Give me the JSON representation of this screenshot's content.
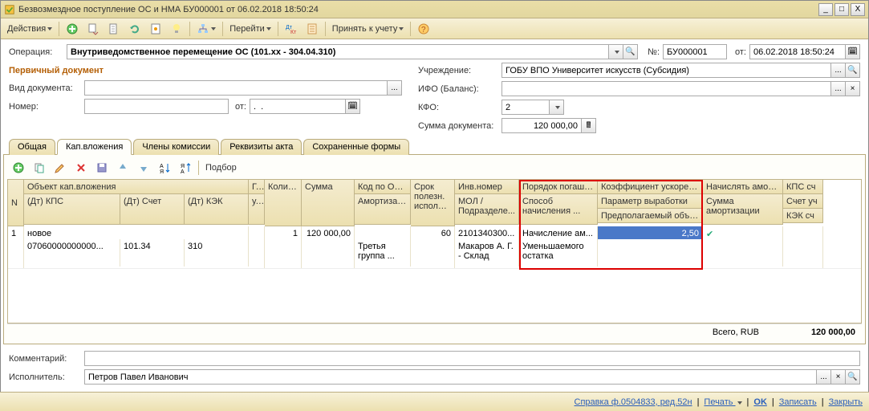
{
  "window": {
    "title": "Безвозмездное поступление ОС и НМА БУ000001 от 06.02.2018 18:50:24"
  },
  "toolbar": {
    "actions": "Действия",
    "goto": "Перейти",
    "accept": "Принять к учету"
  },
  "header": {
    "operation_label": "Операция:",
    "operation": "Внутриведомственное перемещение ОС (101.xx - 304.04.310)",
    "num_label": "№:",
    "num": "БУ000001",
    "from_label": "от:",
    "date": "06.02.2018 18:50:24"
  },
  "left": {
    "section": "Первичный документ",
    "doc_type_label": "Вид документа:",
    "doc_type": "",
    "number_label": "Номер:",
    "number": "",
    "number_from_label": "от:",
    "number_date": ".  .    "
  },
  "right": {
    "org_label": "Учреждение:",
    "org": "ГОБУ ВПО Университет искусств (Субсидия)",
    "ifo_label": "ИФО (Баланс):",
    "ifo": "",
    "kfo_label": "КФО:",
    "kfo": "2",
    "sum_label": "Сумма документа:",
    "sum": "120 000,00"
  },
  "tabs": {
    "t1": "Общая",
    "t2": "Кап.вложения",
    "t3": "Члены комиссии",
    "t4": "Реквизиты акта",
    "t5": "Сохраненные формы"
  },
  "grid_toolbar": {
    "selection": "Подбор"
  },
  "cols": {
    "n": "N",
    "obj": "Объект кап.вложения",
    "dtkps": "(Дт) КПС",
    "dtacc": "(Дт) Счет",
    "dtkek": "(Дт) КЭК",
    "g": "Г...",
    "u": "у...",
    "qty": "Колич...",
    "sum": "Сумма",
    "ok": "Код по ОК...",
    "amort": "Амортизац...",
    "life": "Срок полезн. использ...",
    "inv": "Инв.номер",
    "mol": "МОЛ / Подразделе...",
    "repay": "Порядок погаше...",
    "method": "Способ начисления ...",
    "coef": "Коэффициент ускорения",
    "param": "Параметр выработки",
    "vol": "Предполагаемый объем...",
    "calc": "Начислять аморти...",
    "sumam": "Сумма амортизации",
    "kpsacc": "КПС сч",
    "ktacc": "Счет уч",
    "kekacc": "КЭК сч"
  },
  "row": {
    "n": "1",
    "obj": "новое",
    "kps": "07060000000000...",
    "acc": "101.34",
    "kek": "310",
    "qty": "1",
    "sum": "120 000,00",
    "amort": "Третья группа ...",
    "life": "60",
    "inv": "2101340300...",
    "mol": "Макаров А. Г. - Склад",
    "method1": "Начисление ам...",
    "method2": "Уменьшаемого остатка",
    "coef": "2,50",
    "check": "✔"
  },
  "totals": {
    "label": "Всего, RUB",
    "value": "120 000,00"
  },
  "footer": {
    "comment_label": "Комментарий:",
    "comment": "",
    "executor_label": "Исполнитель:",
    "executor": "Петров Павел Иванович"
  },
  "status": {
    "ref": "Справка ф.0504833, ред.52н",
    "print": "Печать",
    "ok": "OK",
    "save": "Записать",
    "close": "Закрыть"
  }
}
